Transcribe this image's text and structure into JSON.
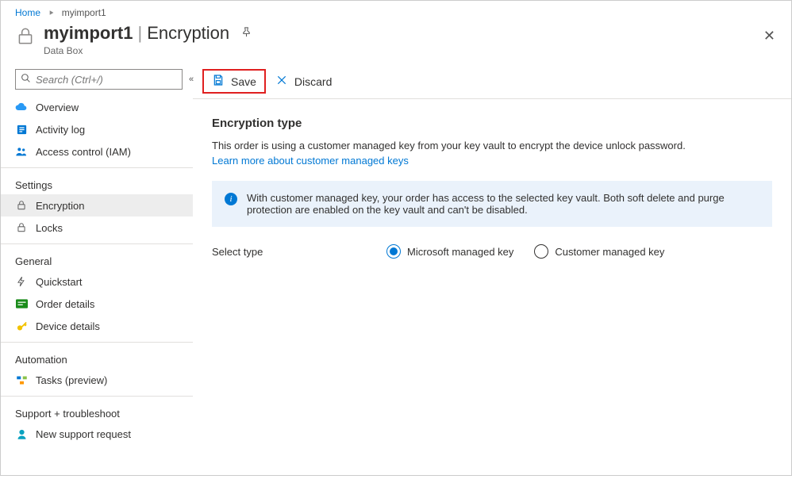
{
  "breadcrumb": {
    "home": "Home",
    "current": "myimport1"
  },
  "header": {
    "resourceName": "myimport1",
    "pageName": "Encryption",
    "service": "Data Box"
  },
  "search": {
    "placeholder": "Search (Ctrl+/)"
  },
  "sidebar": {
    "top": {
      "overview": "Overview",
      "activityLog": "Activity log",
      "accessControl": "Access control (IAM)"
    },
    "settings": {
      "label": "Settings",
      "encryption": "Encryption",
      "locks": "Locks"
    },
    "general": {
      "label": "General",
      "quickstart": "Quickstart",
      "orderDetails": "Order details",
      "deviceDetails": "Device details"
    },
    "automation": {
      "label": "Automation",
      "tasks": "Tasks (preview)"
    },
    "support": {
      "label": "Support + troubleshoot",
      "newSupport": "New support request"
    }
  },
  "toolbar": {
    "save": "Save",
    "discard": "Discard"
  },
  "content": {
    "heading": "Encryption type",
    "description": "This order is using a customer managed key from your key vault to encrypt the device unlock password.",
    "learnMore": "Learn more about customer managed keys",
    "infoMessage": "With customer managed key, your order has access to the selected key vault. Both soft delete and purge protection are enabled on the key vault and can't be disabled.",
    "selectTypeLabel": "Select type",
    "options": {
      "microsoft": "Microsoft managed key",
      "customer": "Customer managed key"
    }
  }
}
